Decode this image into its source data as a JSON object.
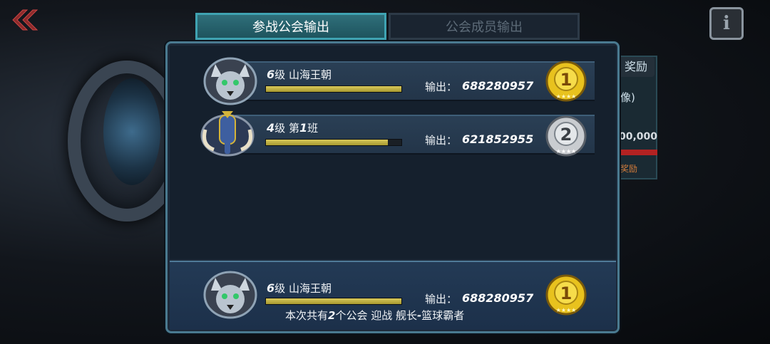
{
  "tabs": [
    {
      "label": "参战公会输出",
      "active": true
    },
    {
      "label": "公会成员输出",
      "active": false
    }
  ],
  "background": {
    "reward_label": "奖励",
    "partial_text_1": "像)",
    "partial_value": "00,000",
    "partial_text_2": "奖励",
    "info_icon": "i"
  },
  "rankings": [
    {
      "level": "6",
      "level_suffix": "级",
      "name": "山海王朝",
      "progress": 1.0,
      "output_label": "输出：",
      "output": "688280957",
      "rank": "1",
      "emblem": "wolf-emblem",
      "badge": "gold-rank-badge"
    },
    {
      "level": "4",
      "level_suffix": "级",
      "name": "第",
      "name_num": "1",
      "name_tail": "班",
      "progress": 0.9,
      "output_label": "输出：",
      "output": "621852955",
      "rank": "2",
      "emblem": "mammoth-emblem",
      "badge": "silver-rank-badge"
    }
  ],
  "my_guild": {
    "level": "6",
    "level_suffix": "级",
    "name": "山海王朝",
    "progress": 1.0,
    "output_label": "输出：",
    "output": "688280957",
    "rank": "1",
    "emblem": "wolf-emblem",
    "badge": "gold-rank-badge"
  },
  "summary": {
    "prefix": "本次共有",
    "count": "2",
    "middle": "个公会 迎战 舰长",
    "dash": "-",
    "target": "篮球霸者"
  },
  "colors": {
    "gold": "#e8c21e",
    "silver": "#c9ccd0",
    "bar_fill": "#c8b84a",
    "tab_active": "#2f6f7a"
  }
}
